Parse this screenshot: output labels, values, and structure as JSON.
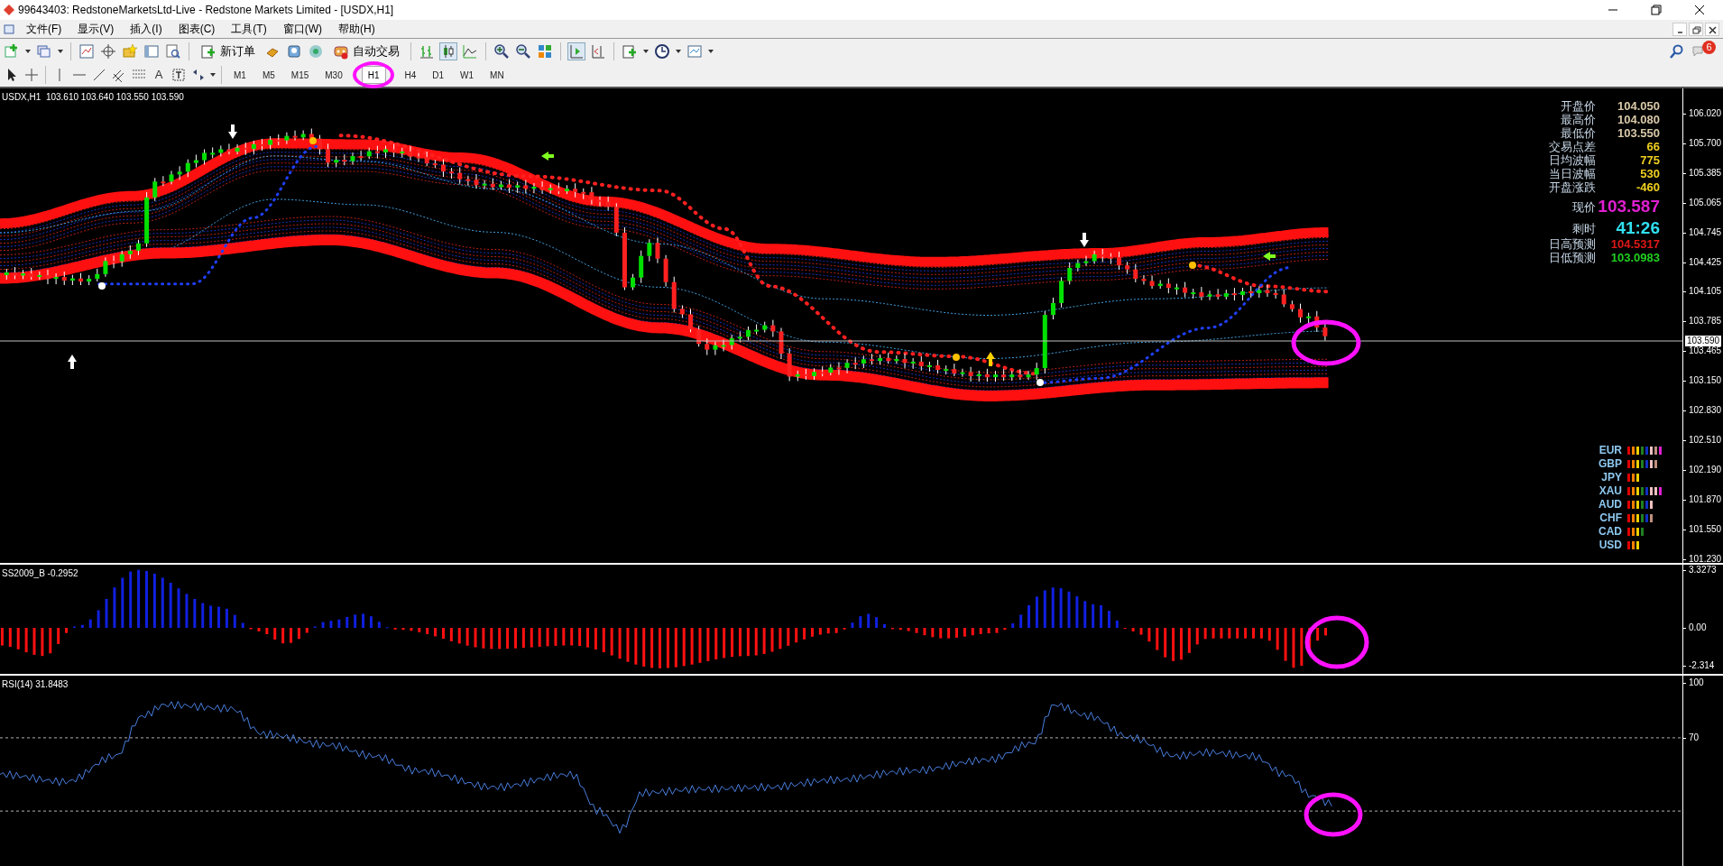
{
  "window": {
    "title": "99643403: RedstoneMarketsLtd-Live - Redstone Markets Limited - [USDX,H1]"
  },
  "menu": [
    "文件(F)",
    "显示(V)",
    "插入(I)",
    "图表(C)",
    "工具(T)",
    "窗口(W)",
    "帮助(H)"
  ],
  "toolbar": {
    "new_order": "新订单",
    "auto_trading": "自动交易",
    "notification_count": "6"
  },
  "drawing_tools": {
    "text_tool": "A"
  },
  "timeframes": [
    {
      "label": "M1",
      "selected": false
    },
    {
      "label": "M5",
      "selected": false
    },
    {
      "label": "M15",
      "selected": false
    },
    {
      "label": "M30",
      "selected": false
    },
    {
      "label": "H1",
      "selected": true
    },
    {
      "label": "H4",
      "selected": false
    },
    {
      "label": "D1",
      "selected": false
    },
    {
      "label": "W1",
      "selected": false
    },
    {
      "label": "MN",
      "selected": false
    }
  ],
  "main_chart": {
    "label": "USDX,H1  103.610 103.640 103.550 103.590",
    "price_ticks": [
      "106.020",
      "105.700",
      "105.385",
      "105.065",
      "104.745",
      "104.425",
      "104.105",
      "103.785",
      "103.465",
      "103.150",
      "102.830",
      "102.510",
      "102.190",
      "101.870",
      "101.550",
      "101.230"
    ],
    "current_price": "103.590",
    "info_panel": [
      {
        "label": "开盘价",
        "value": "104.050",
        "color": "#d8c8a8",
        "kind": "normal"
      },
      {
        "label": "最高价",
        "value": "104.080",
        "color": "#d8c8a8",
        "kind": "normal"
      },
      {
        "label": "最低价",
        "value": "103.550",
        "color": "#d8c8a8",
        "kind": "normal"
      },
      {
        "label": "交易点差",
        "value": "66",
        "color": "#f0d020",
        "kind": "normal"
      },
      {
        "label": "日均波幅",
        "value": "775",
        "color": "#f0d020",
        "kind": "normal"
      },
      {
        "label": "当日波幅",
        "value": "530",
        "color": "#f0d020",
        "kind": "normal"
      },
      {
        "label": "开盘涨跌",
        "value": "-460",
        "color": "#f0d020",
        "kind": "normal"
      },
      {
        "label": "现价",
        "value": "103.587",
        "color": "#e020d0",
        "kind": "large"
      },
      {
        "label": "剩时",
        "value": "41:26",
        "color": "#30e0f0",
        "kind": "large"
      },
      {
        "label": "日高预测",
        "value": "104.5317",
        "color": "#e01818",
        "kind": "normal"
      },
      {
        "label": "日低预测",
        "value": "103.0983",
        "color": "#20d020",
        "kind": "normal"
      }
    ],
    "currency_strength": [
      {
        "currency": "EUR",
        "bars": [
          {
            "color": "#e00000"
          },
          {
            "color": "#ff8000"
          },
          {
            "color": "#f0d000"
          },
          {
            "color": "#208020"
          },
          {
            "color": "#1030c0"
          },
          {
            "color": "#f0c0c0"
          },
          {
            "color": "#c09080"
          },
          {
            "color": "#e020d0"
          }
        ]
      },
      {
        "currency": "GBP",
        "bars": [
          {
            "color": "#e00000"
          },
          {
            "color": "#ff8000"
          },
          {
            "color": "#f0d000"
          },
          {
            "color": "#208020"
          },
          {
            "color": "#1030c0"
          },
          {
            "color": "#f0c0c0"
          },
          {
            "color": "#c09080"
          }
        ]
      },
      {
        "currency": "JPY",
        "bars": [
          {
            "color": "#e00000"
          },
          {
            "color": "#ff8000"
          },
          {
            "color": "#f0d000"
          }
        ]
      },
      {
        "currency": "XAU",
        "bars": [
          {
            "color": "#e00000"
          },
          {
            "color": "#ff8000"
          },
          {
            "color": "#f0d000"
          },
          {
            "color": "#208020"
          },
          {
            "color": "#1030c0"
          },
          {
            "color": "#f0c0c0"
          },
          {
            "color": "#f0c0c0"
          },
          {
            "color": "#e020d0"
          }
        ]
      },
      {
        "currency": "AUD",
        "bars": [
          {
            "color": "#e00000"
          },
          {
            "color": "#ff8000"
          },
          {
            "color": "#f0d000"
          },
          {
            "color": "#208020"
          },
          {
            "color": "#1030c0"
          },
          {
            "color": "#f0c0c0"
          }
        ]
      },
      {
        "currency": "CHF",
        "bars": [
          {
            "color": "#e00000"
          },
          {
            "color": "#ff8000"
          },
          {
            "color": "#f0d000"
          },
          {
            "color": "#208020"
          },
          {
            "color": "#1030c0"
          },
          {
            "color": "#c09080"
          }
        ]
      },
      {
        "currency": "CAD",
        "bars": [
          {
            "color": "#e00000"
          },
          {
            "color": "#ff8000"
          },
          {
            "color": "#f0d000"
          },
          {
            "color": "#208020"
          }
        ]
      },
      {
        "currency": "USD",
        "bars": [
          {
            "color": "#e00000"
          },
          {
            "color": "#ff8000"
          },
          {
            "color": "#f0d000"
          }
        ]
      }
    ]
  },
  "oscillator": {
    "label": "SS2009_B -0.2952",
    "ticks": [
      "3.3273",
      "0.00",
      "-2.314"
    ]
  },
  "rsi": {
    "label": "RSI(14) 31.8483",
    "ticks": [
      "100",
      "70"
    ]
  }
}
